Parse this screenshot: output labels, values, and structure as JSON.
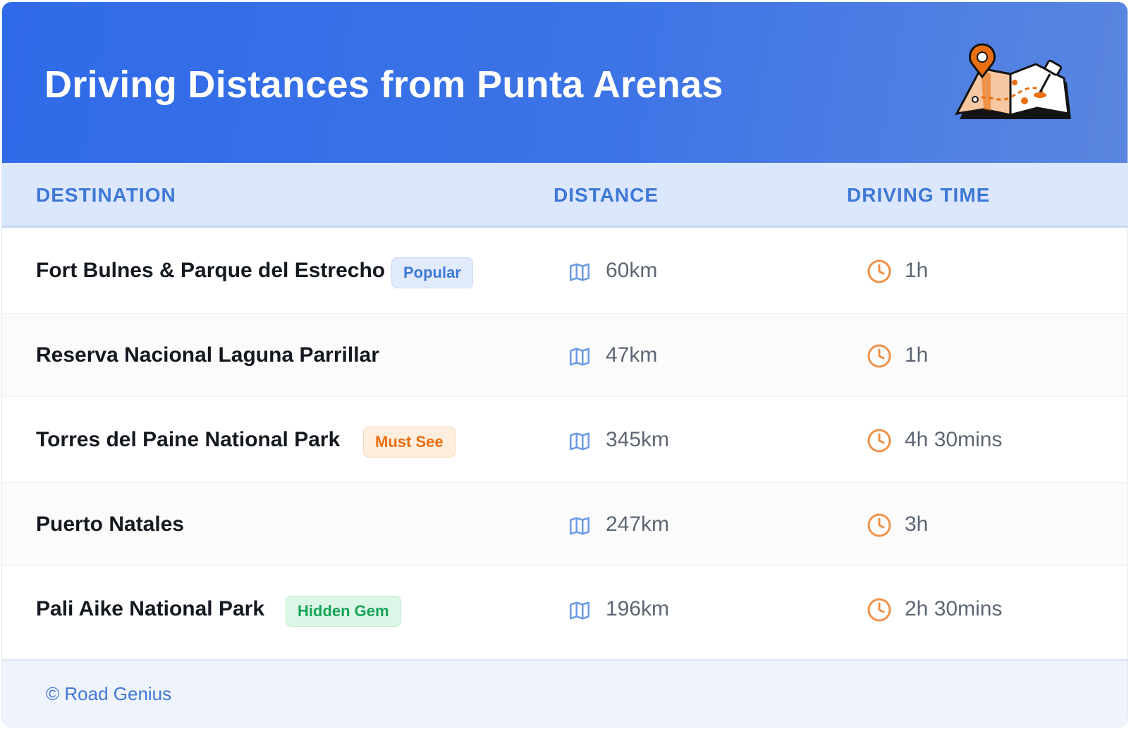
{
  "header": {
    "title": "Driving Distances from Punta Arenas"
  },
  "columns": {
    "destination": "DESTINATION",
    "distance": "DISTANCE",
    "driving_time": "DRIVING TIME"
  },
  "rows": [
    {
      "destination": "Fort Bulnes & Parque del Estrecho",
      "badge": "Popular",
      "distance": "60km",
      "time": "1h"
    },
    {
      "destination": "Reserva Nacional Laguna Parrillar",
      "badge": "",
      "distance": "47km",
      "time": "1h"
    },
    {
      "destination": "Torres del Paine National Park",
      "badge": "Must See",
      "distance": "345km",
      "time": "4h 30mins"
    },
    {
      "destination": "Puerto Natales",
      "badge": "",
      "distance": "247km",
      "time": "3h"
    },
    {
      "destination": "Pali Aike National Park",
      "badge": "Hidden Gem",
      "distance": "196km",
      "time": "2h 30mins"
    }
  ],
  "footer": {
    "credit": "© Road Genius"
  },
  "icons": {
    "header": "map-pin-illustration",
    "distance": "map-icon",
    "time": "clock-icon"
  },
  "colors": {
    "header": "#2f6ae8",
    "accent_blue": "#3f78d6",
    "accent_orange": "#ea6f12",
    "accent_green": "#18a457"
  }
}
